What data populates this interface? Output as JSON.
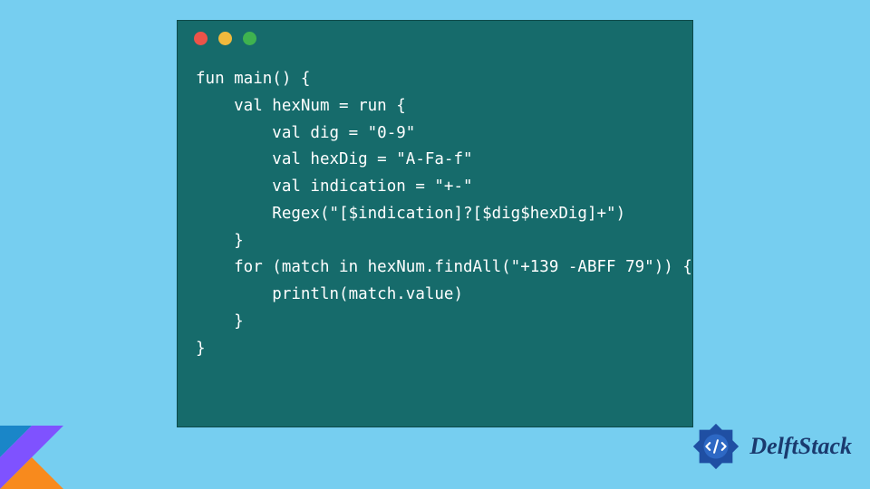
{
  "window": {
    "dots": {
      "red": "#ec5349",
      "yellow": "#f1b93c",
      "green": "#3fb24f"
    }
  },
  "code": {
    "lines": [
      "fun main() {",
      "    val hexNum = run {",
      "        val dig = \"0-9\"",
      "        val hexDig = \"A-Fa-f\"",
      "        val indication = \"+-\"",
      "        Regex(\"[$indication]?[$dig$hexDig]+\")",
      "    }",
      "    for (match in hexNum.findAll(\"+139 -ABFF 79\")) {",
      "        println(match.value)",
      "    }",
      "}"
    ]
  },
  "brand": {
    "name": "DelftStack",
    "color": "#1a3a6e"
  }
}
